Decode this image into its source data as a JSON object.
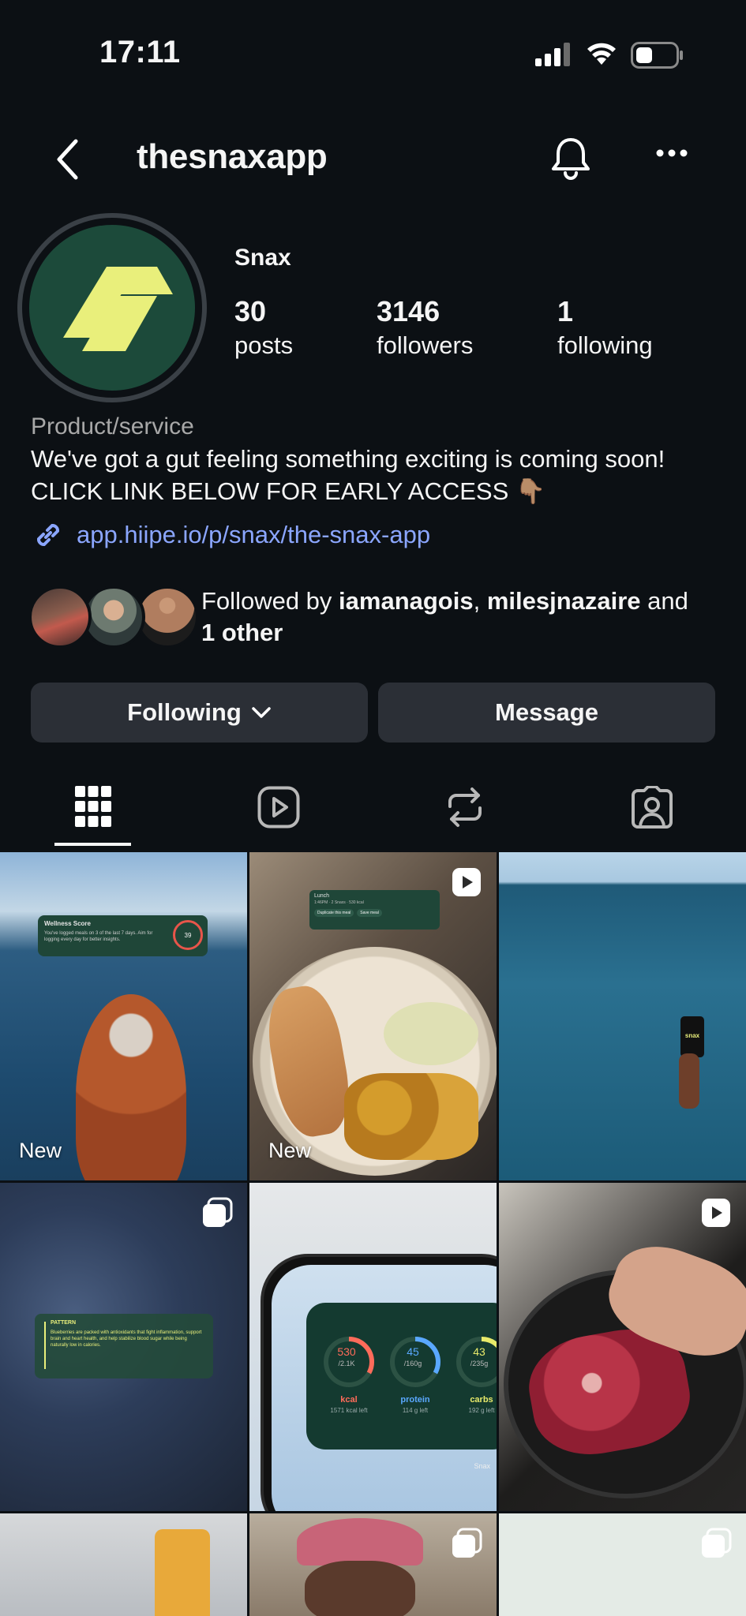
{
  "status_bar": {
    "time": "17:11"
  },
  "header": {
    "username": "thesnaxapp"
  },
  "profile": {
    "display_name": "Snax",
    "stats": [
      {
        "value": "30",
        "label": "posts"
      },
      {
        "value": "3146",
        "label": "followers"
      },
      {
        "value": "1",
        "label": "following"
      }
    ],
    "category": "Product/service",
    "bio_line1": "We've got a gut feeling something exciting is coming soon!",
    "bio_line2": "CLICK LINK BELOW FOR EARLY ACCESS 👇🏽",
    "link": "app.hiipe.io/p/snax/the-snax-app",
    "followed_by": {
      "prefix": "Followed by ",
      "user1": "iamanagois",
      "sep": ", ",
      "user2": "milesjnazaire",
      "and": " and",
      "other": "1 other"
    }
  },
  "buttons": {
    "following": "Following",
    "message": "Message"
  },
  "tabs": [
    "grid-icon",
    "reels-icon",
    "reposts-icon",
    "tagged-icon"
  ],
  "posts": {
    "p1": {
      "label": "New",
      "card_title": "Wellness Score",
      "card_text": "You've logged meals on 3 of the last 7 days. Aim for logging every day for better insights.",
      "score": "39"
    },
    "p2": {
      "label": "New",
      "card_title": "Lunch",
      "card_sub": "1:46PM · 2 Snaxs · 530 kcal",
      "btn1": "Duplicate this meal",
      "btn2": "Save meal"
    },
    "p3": {
      "phone_text": "snax"
    },
    "p4": {
      "card_title": "PATTERN",
      "card_text": "Blueberries are packed with antioxidants that fight inflammation, support brain and heart health, and help stabilize blood sugar while being naturally low in calories."
    },
    "p5": {
      "rings": [
        {
          "value": "530",
          "target": "/2.1K",
          "label": "kcal",
          "left": "1571 kcal left",
          "color": "#ff6b5a"
        },
        {
          "value": "45",
          "target": "/160g",
          "label": "protein",
          "left": "114 g left",
          "color": "#5aa8ff"
        },
        {
          "value": "43",
          "target": "/235g",
          "label": "carbs",
          "left": "192 g left",
          "color": "#e8ea6a"
        }
      ],
      "brand": "Snax"
    }
  }
}
